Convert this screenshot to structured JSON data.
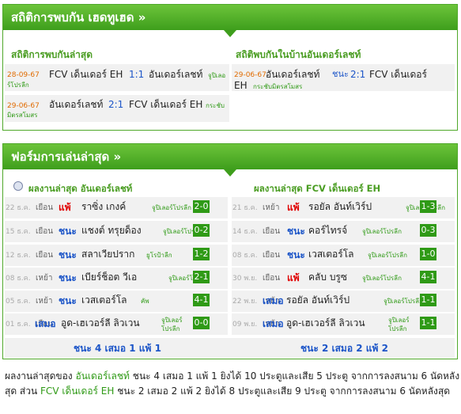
{
  "h2h": {
    "title": "สถิติการพบกัน เฮดทูเฮด",
    "left_title": "สถิติการพบกันล่าสุด",
    "right_title": "สถิติพบกันในบ้านอันเดอร์เลชท์",
    "left_rows": [
      {
        "date": "28-09-67",
        "home": "FCV เด็นเดอร์ EH",
        "score": "1:1",
        "away": "อันเดอร์เลชท์",
        "comp1": "จูปิเลอ",
        "comp2": "ร์โปรลีก"
      },
      {
        "date": "29-06-67",
        "home": "อันเดอร์เลชท์",
        "score": "2:1",
        "away": "FCV เด็นเดอร์ EH",
        "comp1": "กระชับ",
        "comp2": "มิตรสโมสร"
      }
    ],
    "right_rows": [
      {
        "date": "29-06-67",
        "home": "อันเดอร์เลชท์",
        "res": "ชนะ",
        "score": "2:1",
        "away": "FCV เด็นเดอร์",
        "away2": "EH",
        "comp": "กระชับมิตรสโมสร"
      }
    ]
  },
  "form": {
    "title": "ฟอร์มการเล่นล่าสุด",
    "left_title": "ผลงานล่าสุด อันเดอร์เลชท์",
    "right_title": "ผลงานล่าสุด FCV เด็นเดอร์ EH",
    "left_rows": [
      {
        "date": "22 ธ.ค.",
        "venue": "เยือน",
        "res": "แพ้",
        "opp": "ราซิ่ง เกงค์",
        "comp": "จูปิเลอร์โปรลีก",
        "comp2": "",
        "score": "2-0"
      },
      {
        "date": "15 ธ.ค.",
        "venue": "เยือน",
        "res": "ชนะ",
        "opp": "แชงต์ ทรุยด็อง",
        "comp": "จูปิเลอร์โปรลีก",
        "comp2": "",
        "score": "0-2"
      },
      {
        "date": "12 ธ.ค.",
        "venue": "เยือน",
        "res": "ชนะ",
        "opp": "สลาเวียปราก",
        "comp": "ยูโรป้าลีก",
        "comp2": "",
        "score": "1-2"
      },
      {
        "date": "08 ธ.ค.",
        "venue": "เหย้า",
        "res": "ชนะ",
        "opp": "เบียร์ช็อต วีเอ",
        "comp": "จูปิเลอร์โปรลีก",
        "comp2": "",
        "score": "2-1"
      },
      {
        "date": "05 ธ.ค.",
        "venue": "เหย้า",
        "res": "ชนะ",
        "opp": "เวสเตอร์โล",
        "comp": "คัพ",
        "comp2": "",
        "score": "4-1"
      },
      {
        "date": "01 ธ.ค.",
        "venue": "เยือน",
        "res": "เสมอ",
        "opp": "อูด-เฮเวอร์ลี ลิวเวน",
        "comp": "จูปิเลอร์",
        "comp2": "โปรลีก",
        "score": "0-0"
      }
    ],
    "right_rows": [
      {
        "date": "21 ธ.ค.",
        "venue": "เหย้า",
        "res": "แพ้",
        "opp": "รอยัล อันท์เวิร์ป",
        "comp": "จูปิเลอร์โปรลีก",
        "comp2": "",
        "score": "1-3"
      },
      {
        "date": "14 ธ.ค.",
        "venue": "เยือน",
        "res": "ชนะ",
        "opp": "คอร์ไทรจ์",
        "comp": "จูปิเลอร์โปรลีก",
        "comp2": "",
        "score": "0-3"
      },
      {
        "date": "08 ธ.ค.",
        "venue": "เยือน",
        "res": "ชนะ",
        "opp": "เวสเตอร์โล",
        "comp": "จูปิเลอร์โปรลีก",
        "comp2": "",
        "score": "1-0"
      },
      {
        "date": "30 พ.ย.",
        "venue": "เยือน",
        "res": "แพ้",
        "opp": "คลับ บรูซ",
        "comp": "จูปิเลอร์โปรลีก",
        "comp2": "",
        "score": "4-1"
      },
      {
        "date": "22 พ.ย.",
        "venue": "เหย้า",
        "res": "เสมอ",
        "opp": "รอยัล อันท์เวิร์ป",
        "comp": "จูปิเลอร์โปรลีก",
        "comp2": "",
        "score": "1-1"
      },
      {
        "date": "09 พ.ย.",
        "venue": "เหย้า",
        "res": "เสมอ",
        "opp": "อูด-เฮเวอร์ลี ลิวเวน",
        "comp": "จูปิเลอร์",
        "comp2": "โปรลีก",
        "score": "1-1"
      }
    ],
    "left_summary": "ชนะ 4 เสมอ 1 แพ้ 1",
    "right_summary": "ชนะ 2 เสมอ 2 แพ้ 2"
  },
  "summary": {
    "p1": "ผลงานล่าสุดของ",
    "team1": "อันเดอร์เลชท์",
    "p2": "ชนะ 4 เสมอ 1 แพ้ 1 ยิงได้ 10 ประตูและเสีย 5 ประตู จากการลงสนาม 6 นัดหลัง",
    "p3": "สุด ส่วน",
    "team2": "FCV เด็นเดอร์ EH",
    "p4": "ชนะ 2 เสมอ 2 แพ้ 2 ยิงได้ 8 ประตูและเสีย 9 ประตู จากการลงสนาม 6 นัดหลังสุด"
  },
  "colors": {
    "green": "#3e9e1c",
    "win": "#1c55c8",
    "loss": "#e00000",
    "date": "#e06b00"
  }
}
